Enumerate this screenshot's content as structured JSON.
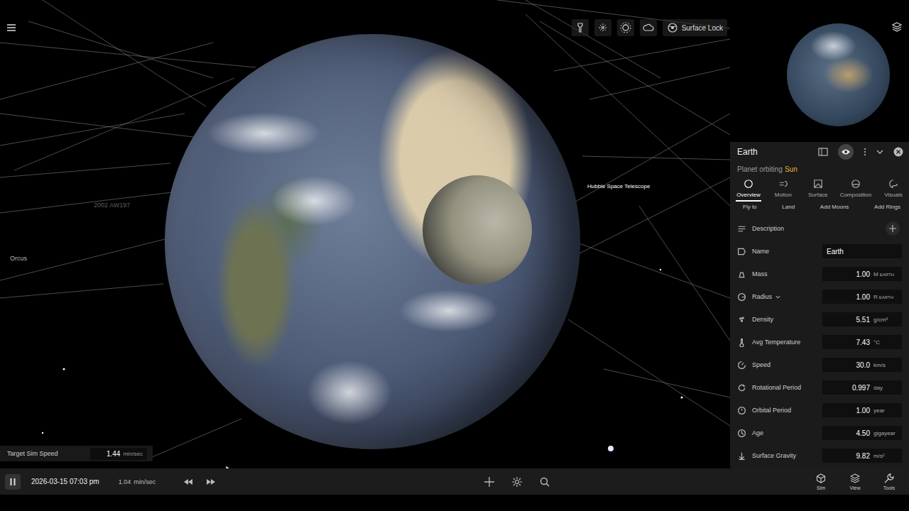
{
  "viewport": {
    "labels": [
      {
        "text": "Hubble Space Telescope"
      },
      {
        "text": "2002 AW197"
      },
      {
        "text": "Orcus"
      }
    ],
    "toolbar": {
      "surface_lock": "Surface Lock"
    },
    "target_sim_speed": {
      "label": "Target Sim Speed",
      "value": "1.44",
      "unit": "min/sec"
    }
  },
  "panel": {
    "title": "Earth",
    "eye_on": true,
    "subtitle": "Planet orbiting",
    "parent": "Sun",
    "tabs": [
      {
        "label": "Overview",
        "selected": true
      },
      {
        "label": "Motion",
        "selected": false
      },
      {
        "label": "Surface",
        "selected": false
      },
      {
        "label": "Composition",
        "selected": false
      },
      {
        "label": "Visuals",
        "selected": false
      }
    ],
    "actions": [
      "Fly to",
      "Land",
      "Add Moons",
      "Add Rings"
    ],
    "properties": [
      {
        "kind": "button",
        "label": "Description"
      },
      {
        "kind": "text",
        "label": "Name",
        "value": "Earth"
      },
      {
        "kind": "number",
        "label": "Mass",
        "value": "1.00",
        "unit": "M",
        "unit_small": "EARTH",
        "dropdown": false
      },
      {
        "kind": "number",
        "label": "Radius",
        "value": "1.00",
        "unit": "R",
        "unit_small": "EARTH",
        "dropdown": true
      },
      {
        "kind": "number",
        "label": "Density",
        "value": "5.51",
        "unit": "g/cm³",
        "dropdown": false
      },
      {
        "kind": "number",
        "label": "Avg Temperature",
        "value": "7.43",
        "unit": "°C",
        "dropdown": false
      },
      {
        "kind": "number",
        "label": "Speed",
        "value": "30.0",
        "unit": "km/s",
        "dropdown": false
      },
      {
        "kind": "number",
        "label": "Rotational Period",
        "value": "0.997",
        "unit": "day",
        "dropdown": false
      },
      {
        "kind": "number",
        "label": "Orbital Period",
        "value": "1.00",
        "unit": "year",
        "dropdown": false
      },
      {
        "kind": "number",
        "label": "Age",
        "value": "4.50",
        "unit": "gigayear",
        "dropdown": false
      },
      {
        "kind": "number",
        "label": "Surface Gravity",
        "value": "9.82",
        "unit": "m/s²",
        "dropdown": false
      }
    ]
  },
  "bottom_bar": {
    "date": "2026-03-15 07:03 pm",
    "speed": "1.04",
    "speed_unit": "min/sec",
    "nav": [
      "Sim",
      "View",
      "Tools"
    ]
  }
}
